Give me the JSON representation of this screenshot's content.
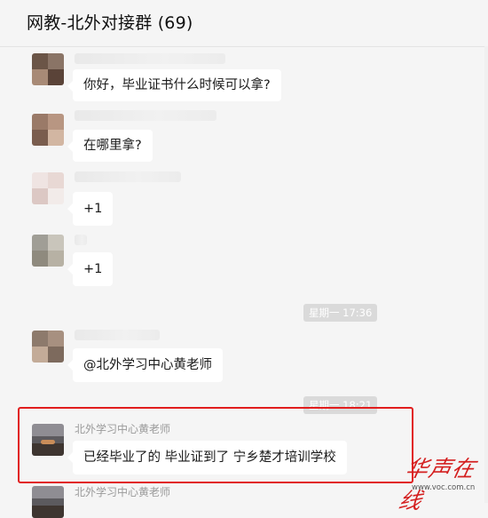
{
  "window": {
    "title": "网教-北外对接群 (69)"
  },
  "messages": [
    {
      "text": "你好，毕业证书什么时候可以拿?"
    },
    {
      "text": "在哪里拿?"
    },
    {
      "text": "+1"
    },
    {
      "text": "+1"
    },
    {
      "text": "@北外学习中心黄老师"
    },
    {
      "sender": "北外学习中心黄老师",
      "text": "已经毕业了的 毕业证到了 宁乡楚才培训学校"
    },
    {
      "sender": "北外学习中心黄老师"
    }
  ],
  "timestamps": [
    "星期一 17:36",
    "星期一 18:21"
  ],
  "watermark": {
    "logo": "华声在线",
    "url": "www.voc.com.cn"
  },
  "colors": {
    "highlight_border": "#e11d1d",
    "bubble": "#ffffff",
    "background": "#f5f5f5"
  }
}
